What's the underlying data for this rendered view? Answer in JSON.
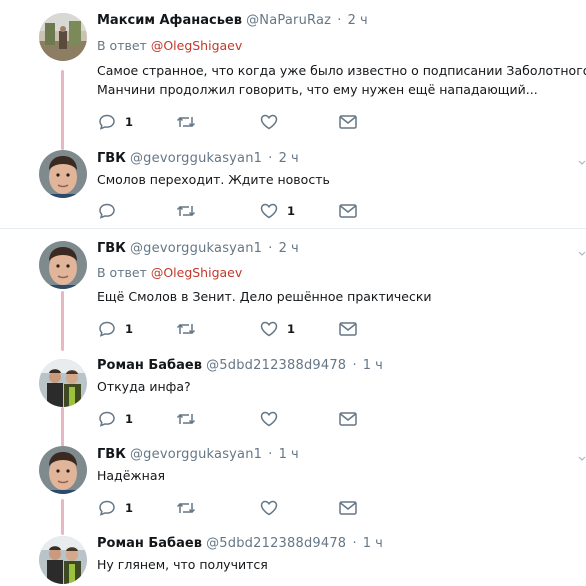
{
  "tweets": [
    {
      "name": "Максим Афанасьев",
      "handle": "@NaParuRaz",
      "time": "2 ч",
      "reply_prefix": "В ответ",
      "reply_to": "@OlegShigaev",
      "text_lines": [
        "Самое странное, что когда уже было известно о подписании Заболотного,",
        "Манчини продолжил говорить, что ему нужен ещё нападающий..."
      ],
      "reply_count": "1",
      "like_count": ""
    },
    {
      "name": "ГВК",
      "handle": "@gevorggukasyan1",
      "time": "2 ч",
      "text_lines": [
        "Смолов переходит. Ждите новость"
      ],
      "reply_count": "",
      "like_count": "1"
    },
    {
      "name": "ГВК",
      "handle": "@gevorggukasyan1",
      "time": "2 ч",
      "reply_prefix": "В ответ",
      "reply_to": "@OlegShigaev",
      "text_lines": [
        "Ещё Смолов в Зенит. Дело решённое практически"
      ],
      "reply_count": "1",
      "like_count": "1"
    },
    {
      "name": "Роман Бабаев",
      "handle": "@5dbd212388d9478",
      "time": "1 ч",
      "text_lines": [
        "Откуда инфа?"
      ],
      "reply_count": "1",
      "like_count": ""
    },
    {
      "name": "ГВК",
      "handle": "@gevorggukasyan1",
      "time": "1 ч",
      "text_lines": [
        "Надёжная"
      ],
      "reply_count": "1",
      "like_count": ""
    },
    {
      "name": "Роман Бабаев",
      "handle": "@5dbd212388d9478",
      "time": "1 ч",
      "text_lines": [
        "Ну глянем, что получится"
      ],
      "reply_count": "",
      "like_count": ""
    }
  ],
  "colors": {
    "accent_link": "#c0392b",
    "thread_line": "#e6b9c2",
    "muted": "#657786",
    "icon": "#657786"
  }
}
